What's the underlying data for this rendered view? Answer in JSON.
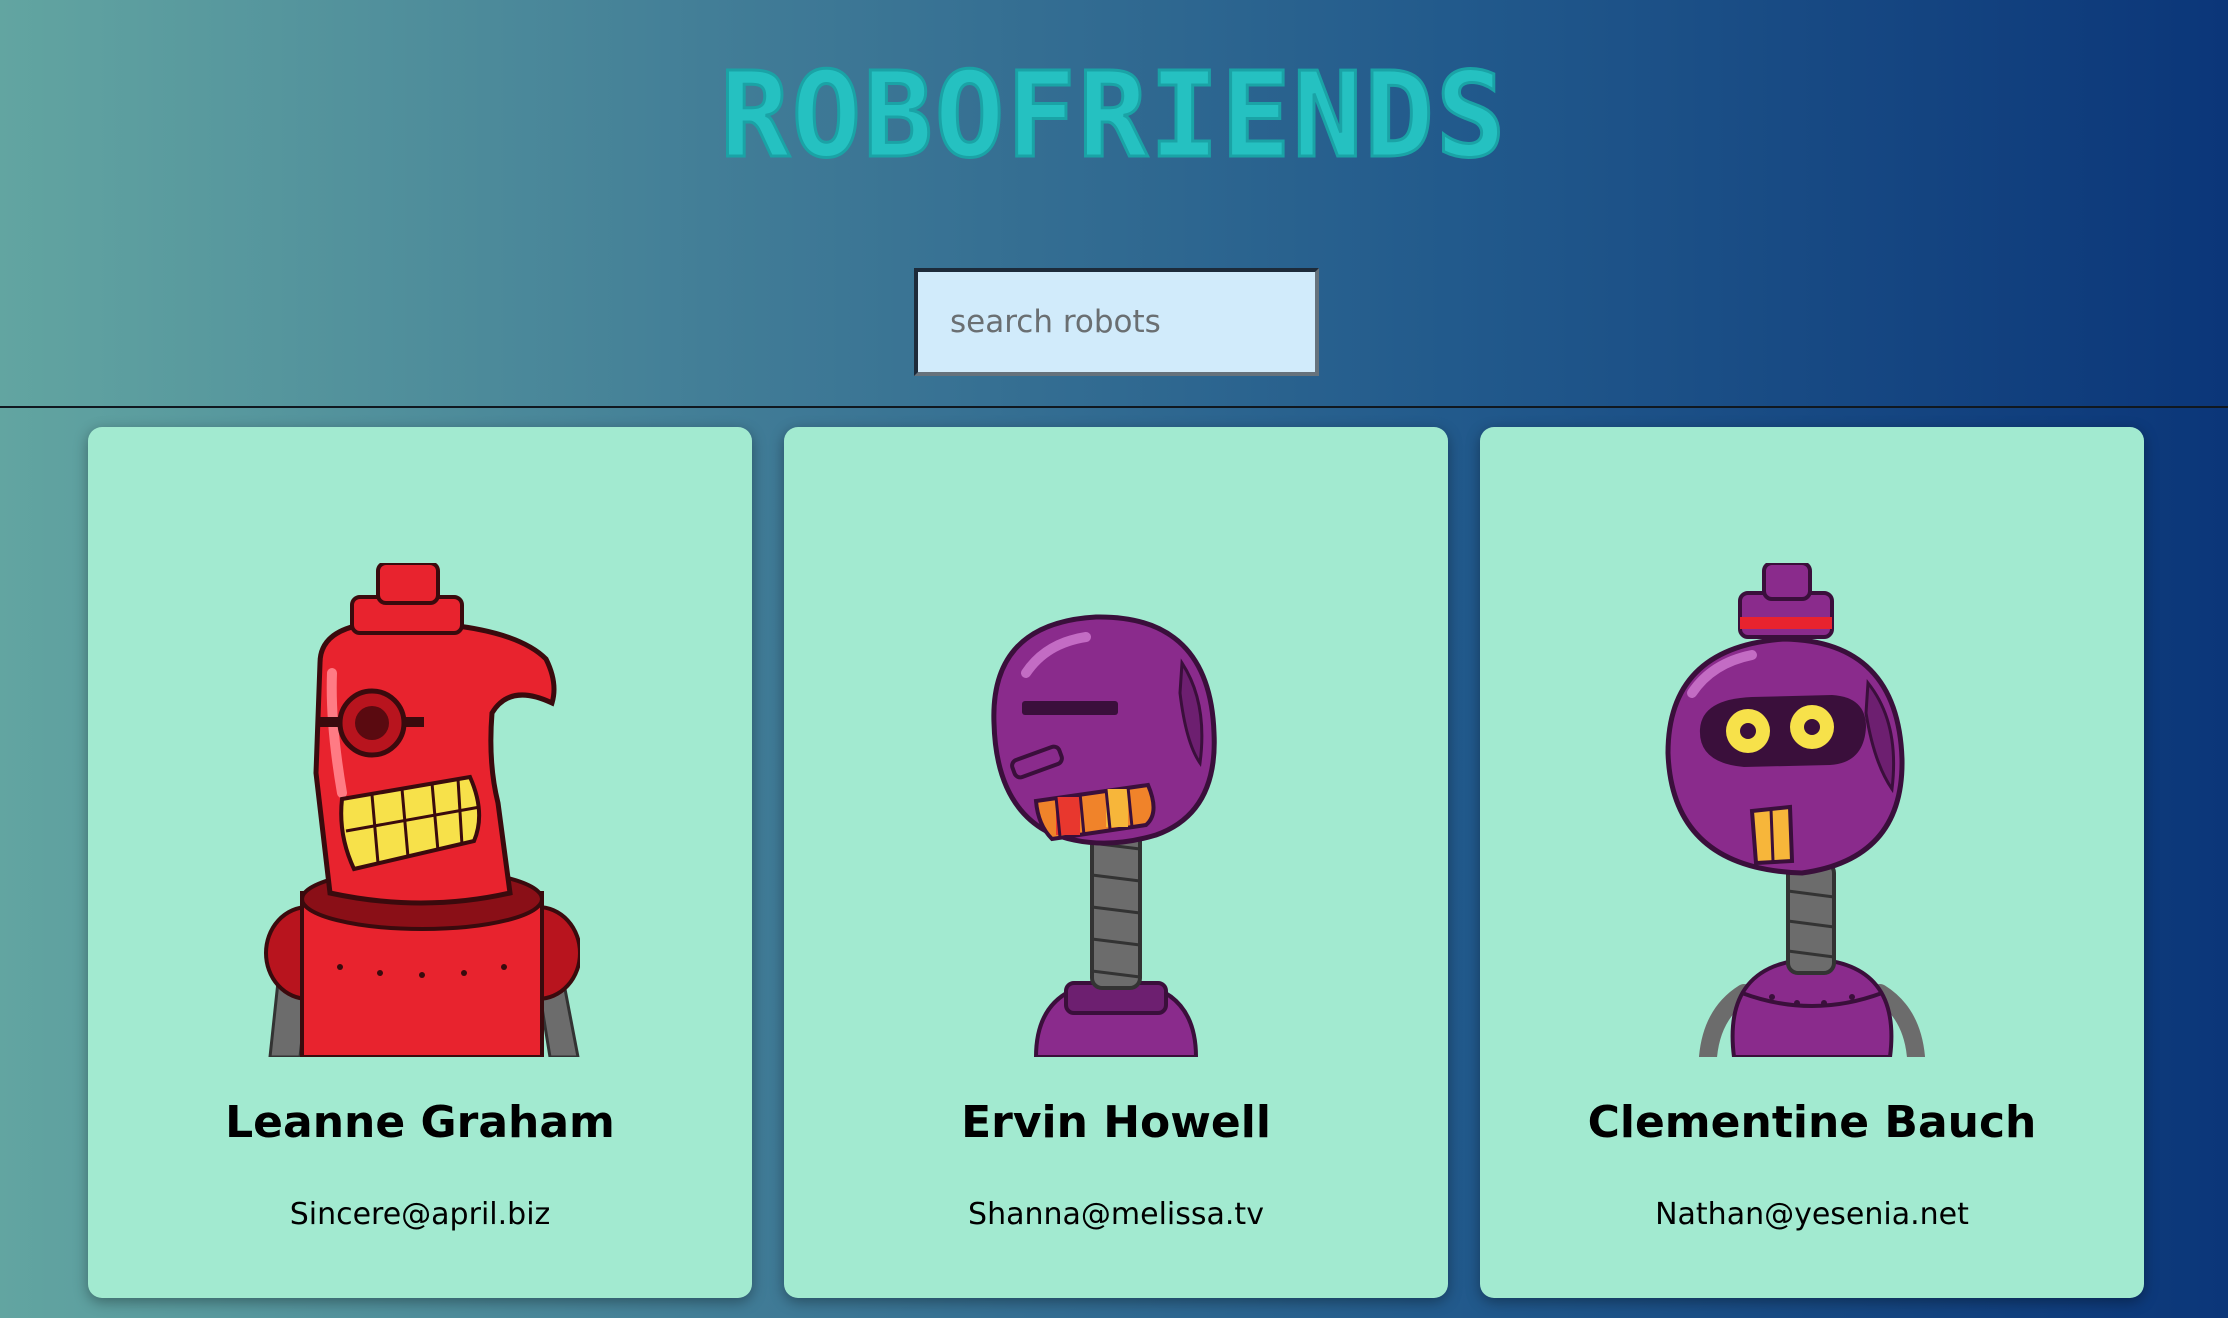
{
  "header": {
    "title": "ROBOFRIENDS",
    "title_color": "#25c1c1"
  },
  "search": {
    "placeholder": "search robots",
    "value": ""
  },
  "robots": [
    {
      "name": "Leanne Graham",
      "email": "Sincere@april.biz",
      "avatar": "red-robot-avatar",
      "color": "#e8232e"
    },
    {
      "name": "Ervin Howell",
      "email": "Shanna@melissa.tv",
      "avatar": "purple-robot-avatar",
      "color": "#8a2b8c"
    },
    {
      "name": "Clementine Bauch",
      "email": "Nathan@yesenia.net",
      "avatar": "purple-robot-avatar",
      "color": "#8a2b8c"
    }
  ],
  "colors": {
    "card_background": "#a2ead0",
    "search_background": "#d1ebfb",
    "gradient_start": "#62a5a1",
    "gradient_end": "#0b3679"
  }
}
